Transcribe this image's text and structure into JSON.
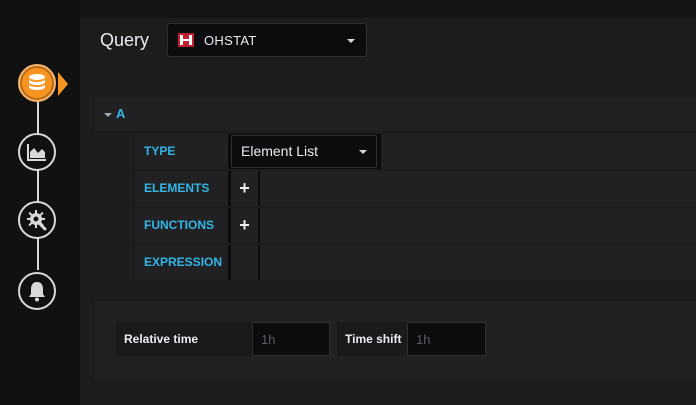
{
  "header": {
    "title": "Query"
  },
  "datasource": {
    "name": "OHSTAT"
  },
  "rail": {
    "items": [
      {
        "icon": "database-icon",
        "active": true
      },
      {
        "icon": "area-chart-icon",
        "active": false
      },
      {
        "icon": "gear-wrench-icon",
        "active": false
      },
      {
        "icon": "bell-icon",
        "active": false
      }
    ]
  },
  "query": {
    "ref_id": "A",
    "type_label": "TYPE",
    "type_value": "Element List",
    "elements_label": "ELEMENTS",
    "functions_label": "FUNCTIONS",
    "expression_label": "EXPRESSION",
    "add_symbol": "+"
  },
  "options": {
    "relative_time_label": "Relative time",
    "relative_time_placeholder": "1h",
    "time_shift_label": "Time shift",
    "time_shift_placeholder": "1h"
  },
  "colors": {
    "accent": "#33b5e5",
    "active": "#f79520",
    "background": "#141414"
  }
}
